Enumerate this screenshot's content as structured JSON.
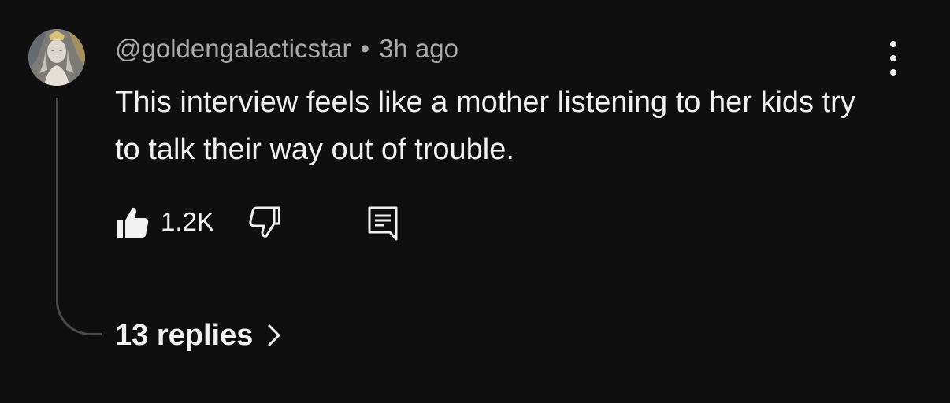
{
  "comment": {
    "author": "@goldengalacticstar",
    "separator": "•",
    "timestamp": "3h ago",
    "text": "This interview feels like a mother listening to her kids try to talk their way out of trouble.",
    "like_count": "1.2K",
    "replies_label": "13 replies"
  },
  "icons": {
    "avatar": "avatar-image",
    "more": "more-vertical-icon",
    "like": "thumbs-up-icon",
    "dislike": "thumbs-down-icon",
    "reply": "reply-comment-icon",
    "chevron": "chevron-right-icon"
  },
  "colors": {
    "background": "#0f0f0f",
    "text_primary": "#f1f1f1",
    "text_secondary": "#aaaaaa",
    "thread_line": "#4a4a4a"
  }
}
